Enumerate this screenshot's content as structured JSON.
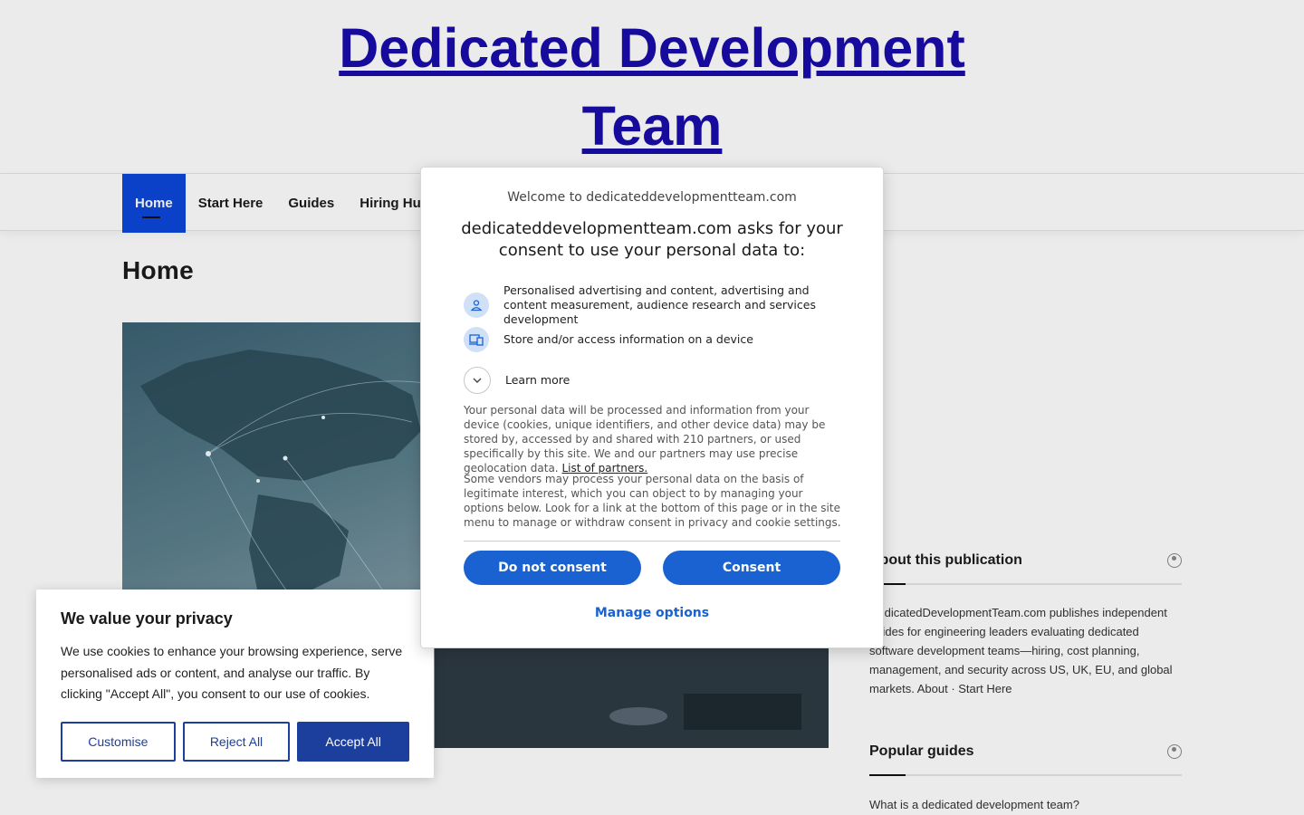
{
  "site": {
    "title": "Dedicated Development Team"
  },
  "nav": {
    "items": [
      "Home",
      "Start Here",
      "Guides",
      "Hiring Hub"
    ]
  },
  "page": {
    "title": "Home"
  },
  "sidebar": {
    "about_title": "About this publication",
    "about_text": "DedicatedDevelopmentTeam.com publishes independent guides for engineering leaders evaluating dedicated software development teams—hiring, cost planning, management, and security across US, UK, EU, and global markets. About · Start Here",
    "popular_title": "Popular guides",
    "popular_first": "What is a dedicated development team?"
  },
  "cookie_banner": {
    "title": "We value your privacy",
    "text": "We use cookies to enhance your browsing experience, serve personalised ads or content, and analyse our traffic. By clicking \"Accept All\", you consent to our use of cookies.",
    "customise": "Customise",
    "reject": "Reject All",
    "accept": "Accept All"
  },
  "consent_modal": {
    "welcome": "Welcome to dedicateddevelopmentteam.com",
    "heading": "dedicateddevelopmentteam.com asks for your consent to use your personal data to:",
    "purpose1": "Personalised advertising and content, advertising and content measurement, audience research and services development",
    "purpose2": "Store and/or access information on a device",
    "learn_more": "Learn more",
    "para1": "Your personal data will be processed and information from your device (cookies, unique identifiers, and other device data) may be stored by, accessed by and shared with 210 partners, or used specifically by this site. We and our partners may use precise geolocation data.",
    "partners_link": "List of partners.",
    "para2": "Some vendors may process your personal data on the basis of legitimate interest, which you can object to by managing your options below. Look for a link at the bottom of this page or in the site menu to manage or withdraw consent in privacy and cookie settings.",
    "do_not_consent": "Do not consent",
    "consent": "Consent",
    "manage": "Manage options"
  },
  "colors": {
    "nav_active": "#0d47d9",
    "consent_blue": "#1a62d1",
    "banner_blue": "#1c3f9e",
    "title_link": "#1a0dab"
  }
}
